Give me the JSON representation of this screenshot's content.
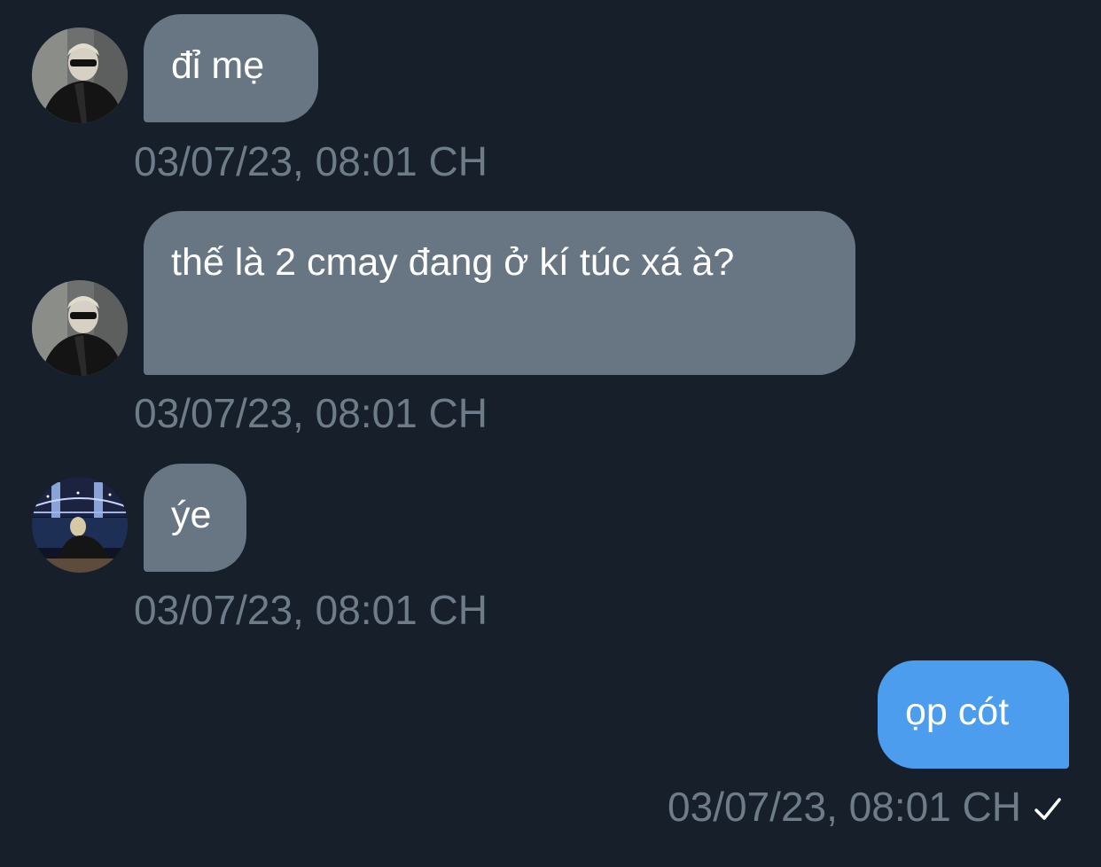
{
  "messages": [
    {
      "direction": "incoming",
      "avatar": "profile-photo-dark",
      "text": "đỉ mẹ",
      "timestamp": "03/07/23, 08:01 CH"
    },
    {
      "direction": "incoming",
      "avatar": "profile-photo-dark",
      "text": "thế là 2 cmay đang ở kí túc xá à?",
      "timestamp": "03/07/23, 08:01 CH"
    },
    {
      "direction": "incoming",
      "avatar": "profile-photo-tower-bridge",
      "text": "ýe",
      "timestamp": "03/07/23, 08:01 CH"
    },
    {
      "direction": "outgoing",
      "text": "ọp cót",
      "timestamp": "03/07/23, 08:01 CH",
      "status_icon": "check-icon"
    }
  ],
  "colors": {
    "background": "#17202a",
    "incoming_bubble": "#687684",
    "outgoing_bubble": "#4c9ded",
    "timestamp": "#6e7c8a",
    "text": "#ffffff"
  }
}
